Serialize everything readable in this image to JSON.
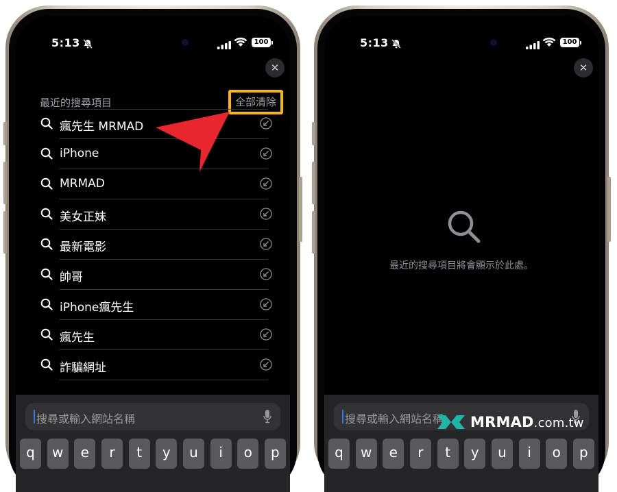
{
  "status_bar": {
    "time": "5:13",
    "battery": "100"
  },
  "left_screen": {
    "section_title": "最近的搜尋項目",
    "clear_all_label": "全部清除",
    "recent_searches": [
      {
        "label": "瘋先生 MRMAD"
      },
      {
        "label": "iPhone"
      },
      {
        "label": "MRMAD"
      },
      {
        "label": "美女正妹"
      },
      {
        "label": "最新電影"
      },
      {
        "label": "帥哥"
      },
      {
        "label": "iPhone瘋先生"
      },
      {
        "label": "瘋先生"
      },
      {
        "label": "詐騙網址"
      }
    ]
  },
  "right_screen": {
    "empty_message": "最近的搜尋項目將會顯示於此處。"
  },
  "address_bar": {
    "placeholder": "搜尋或輸入網站名稱"
  },
  "keyboard": {
    "row1": [
      "q",
      "w",
      "e",
      "r",
      "t",
      "y",
      "u",
      "i",
      "o",
      "p"
    ]
  },
  "watermark": {
    "brand": "MRMAD",
    "domain": ".com.tw"
  },
  "colors": {
    "highlight": "#f5b80f",
    "arrow": "#e8262e",
    "caret": "#3478f6"
  }
}
